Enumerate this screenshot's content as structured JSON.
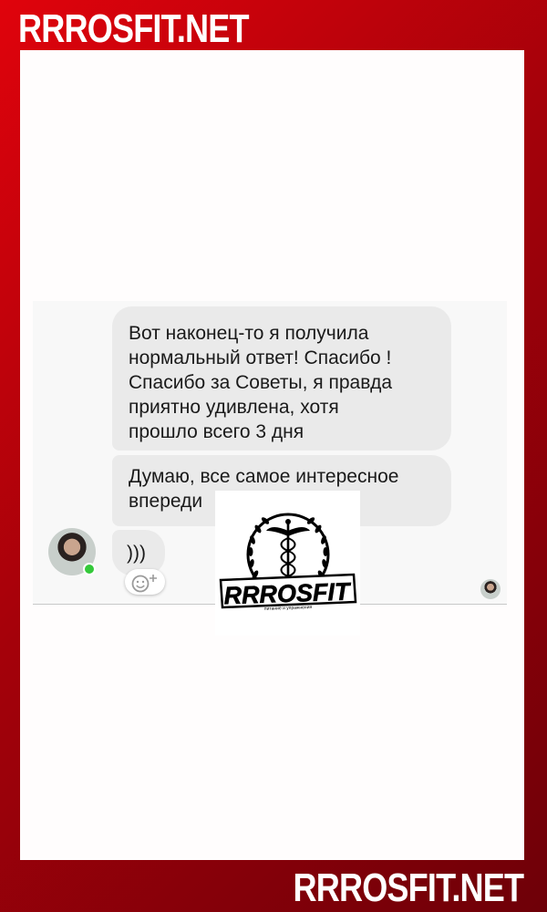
{
  "brand": {
    "top_text": "RRROSFIT.NET",
    "bottom_text": "RRROSFIT.NET"
  },
  "chat": {
    "messages": [
      {
        "text": "Вот наконец-то я получила\nнормальный ответ! Спасибо !\nСпасибо за Советы, я правда\nприятно удивлена, хотя\nпрошло всего 3 дня"
      },
      {
        "text": "Думаю, все самое интересное\nвпереди"
      },
      {
        "text": ")))"
      }
    ],
    "sender_status": "online",
    "status_color": "#34c93a"
  },
  "logo": {
    "name": "RRROSFIT",
    "tagline": "питание и упражнения"
  },
  "icons": {
    "reaction": "add-reaction-icon",
    "emblem": "caduceus-wreath-icon"
  },
  "colors": {
    "frame_red": "#c8020c",
    "bubble_gray": "#eaeaea"
  }
}
